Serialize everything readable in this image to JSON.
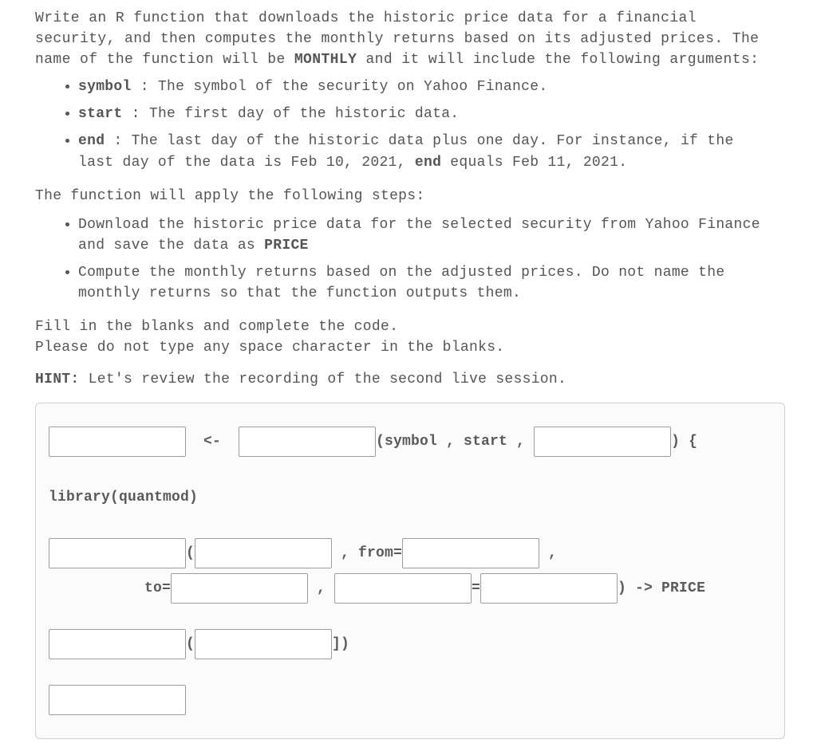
{
  "intro": {
    "pre": "Write an R function that downloads the historic price data for a financial security, and then computes the monthly returns based on its adjusted prices.  The name of the function will be ",
    "fn_name": "MONTHLY",
    "post": " and it will include the following arguments:"
  },
  "args": [
    {
      "name": "symbol",
      "pad": "  ",
      "desc": "The symbol of the security on Yahoo Finance."
    },
    {
      "name": "start",
      "pad": "   ",
      "desc": "The first day of the historic data."
    },
    {
      "name": "end",
      "pad": "     ",
      "desc_pre": "The last day of the historic data plus one day.  For instance, if the last day of the data is Feb 10, 2021,  ",
      "end_bold": "end",
      "desc_post": " equals Feb 11, 2021."
    }
  ],
  "steps_lead": "The function will apply the following steps:",
  "steps": [
    {
      "pre": "Download the historic price data for the selected security from Yahoo Finance and save the data as ",
      "bold": "PRICE"
    },
    {
      "pre": "Compute the monthly returns based on the adjusted prices.  Do not name the monthly returns so that the function outputs them."
    }
  ],
  "fill1": "Fill in the blanks and complete the code.",
  "fill2": "Please do not type any space character in the blanks.",
  "hint_label": "HINT:",
  "hint_text": "  Let's review the recording of the second live session.",
  "code": {
    "l1_assign": "  <-  ",
    "l1_paren_args": "(symbol , start , ",
    "l1_close": ") {",
    "l2": "library(quantmod)",
    "l3_open": "(",
    "l3_from": " , from=",
    "l3_comma": " ,",
    "l4_to_label": "to=",
    "l4_c1": " , ",
    "l4_eq": "=",
    "l4_close": ") -> PRICE",
    "l5_open": "(",
    "l5_close": "])"
  }
}
